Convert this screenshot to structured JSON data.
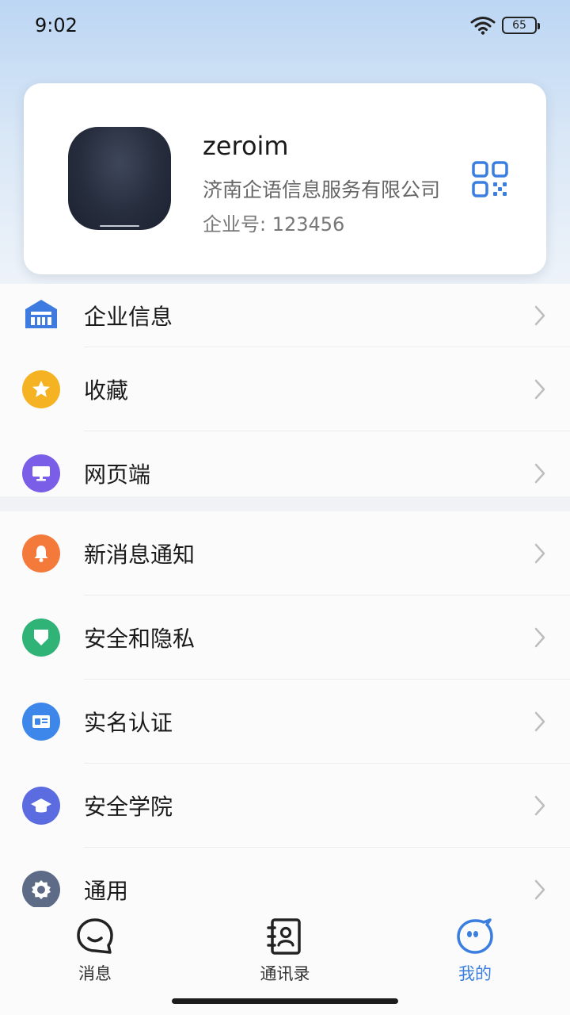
{
  "status_bar": {
    "time": "9:02",
    "battery": "65",
    "wifi_icon": "wifi-icon"
  },
  "profile": {
    "name": "zeroim",
    "company": "济南企语信息服务有限公司",
    "enterprise_id": "企业号: 123456",
    "qr_icon": "qr-code-icon"
  },
  "menu_group_1": [
    {
      "label": "企业信息",
      "icon": "building-icon",
      "color": "#3d7be0"
    },
    {
      "label": "收藏",
      "icon": "star-icon",
      "color": "#f5b324"
    },
    {
      "label": "网页端",
      "icon": "monitor-icon",
      "color": "#7a5ee8"
    }
  ],
  "menu_group_2": [
    {
      "label": "新消息通知",
      "icon": "bell-icon",
      "color": "#f47a3c"
    },
    {
      "label": "安全和隐私",
      "icon": "shield-icon",
      "color": "#2fb377"
    },
    {
      "label": "实名认证",
      "icon": "id-card-icon",
      "color": "#3d86ea"
    },
    {
      "label": "安全学院",
      "icon": "graduation-cap-icon",
      "color": "#5b6be0"
    },
    {
      "label": "通用",
      "icon": "gear-icon",
      "color": "#5d6b86"
    }
  ],
  "tabs": [
    {
      "label": "消息",
      "icon": "chat-bubble-icon",
      "active": false
    },
    {
      "label": "通讯录",
      "icon": "contacts-book-icon",
      "active": false
    },
    {
      "label": "我的",
      "icon": "mascot-face-icon",
      "active": true
    }
  ],
  "colors": {
    "accent": "#3a7ee0",
    "header_gradient_top": "#bcd6f3"
  }
}
